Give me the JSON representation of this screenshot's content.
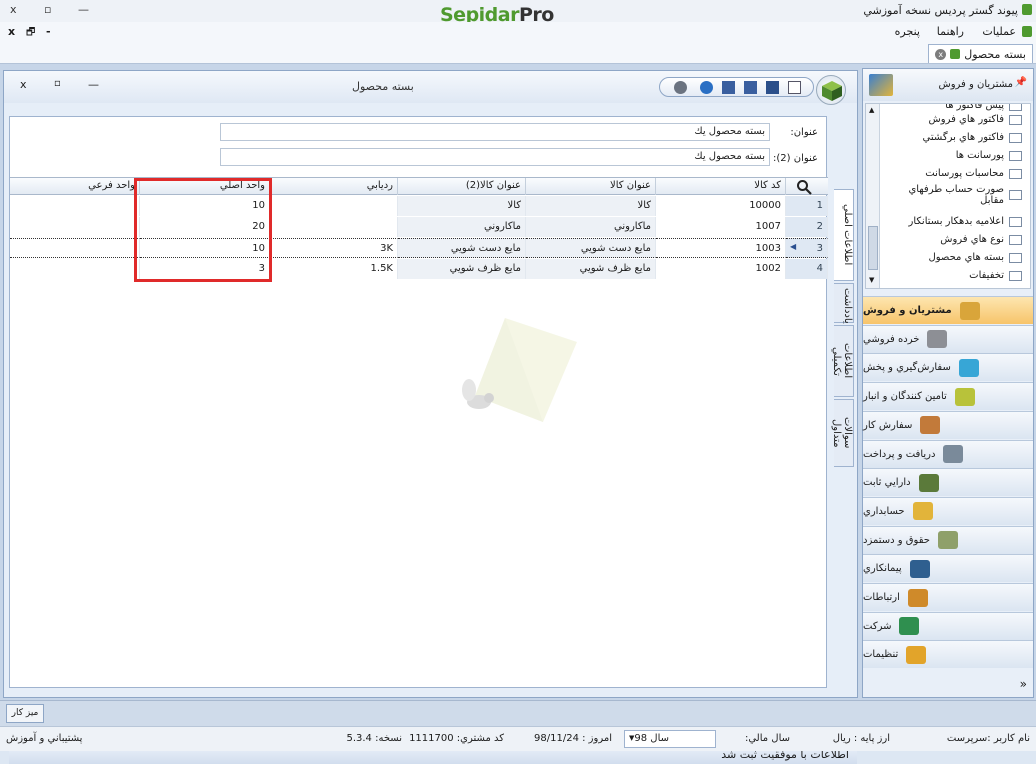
{
  "app": {
    "title": "پیوند گستر پردیس نسخه آموزشي",
    "logo_sepidar": "Sepidar",
    "logo_pro": "Pro"
  },
  "window_controls": {
    "close": "x",
    "restore": "▫",
    "minimize": "—"
  },
  "menu": {
    "items": [
      "عمليات",
      "راهنما",
      "پنجره"
    ]
  },
  "doc_tab": {
    "label": "بسته محصول"
  },
  "child_window": {
    "title": "بسته محصول",
    "vertical_tabs": [
      "اطلاعات اصلي",
      "يادداشت",
      "اطلاعات تكميلي",
      "سوالات متداول"
    ]
  },
  "form": {
    "title_label": "عنوان:",
    "title_value": "بسته محصول يك",
    "title2_label": "عنوان (2):",
    "title2_value": "بسته محصول يك"
  },
  "grid": {
    "columns": [
      "کد کالا",
      "عنوان کالا",
      "عنوان کالا(2)",
      "رديابي",
      "واحد اصلي",
      "واحد فرعي"
    ],
    "rows": [
      {
        "num": "1",
        "code": "10000",
        "title": "كالا",
        "title2": "كالا",
        "track": "",
        "main_unit": "10",
        "sub_unit": ""
      },
      {
        "num": "2",
        "code": "1007",
        "title": "ماكاروني",
        "title2": "ماكاروني",
        "track": "",
        "main_unit": "20",
        "sub_unit": ""
      },
      {
        "num": "3",
        "code": "1003",
        "title": "مايع دست شويي",
        "title2": "مايع دست شويي",
        "track": "3K",
        "main_unit": "10",
        "sub_unit": ""
      },
      {
        "num": "4",
        "code": "1002",
        "title": "مايع ظرف شويي",
        "title2": "مايع ظرف شويي",
        "track": "1.5K",
        "main_unit": "3",
        "sub_unit": ""
      }
    ]
  },
  "status_message": "اطلاعات با موفقيت ثبت شد",
  "nav": {
    "header": "مشتريان و فروش",
    "list": [
      "پيش فاكتور ها",
      "فاكتور هاي فروش",
      "فاكتور هاي برگشتي",
      "پورسانت ها",
      "محاسبات پورسانت",
      "صورت حساب طرفهاي مقابل",
      "اعلاميه بدهكار بستانكار",
      "نوع هاي فروش",
      "بسته هاي محصول",
      "تخفيفات"
    ],
    "buttons": [
      "مشتريان و فروش",
      "خرده فروشي",
      "سفارش‌گيري و پخش",
      "تامين كنندگان و انبار",
      "سفارش كار",
      "دريافت و پرداخت",
      "دارايي ثابت",
      "حسابداري",
      "حقوق و دستمزد",
      "پيمانكاري",
      "ارتباطات",
      "شركت",
      "تنظيمات"
    ],
    "button_colors": [
      "#d9a53a",
      "#8d8f95",
      "#37a6d6",
      "#b8c23a",
      "#c27a3a",
      "#7a8a9a",
      "#5b7a3a",
      "#e2b43a",
      "#8fa06a",
      "#2f5f8f",
      "#cf8a2a",
      "#2f8f4f",
      "#e2a42a"
    ]
  },
  "taskbar": {
    "button": "ميز كار"
  },
  "infobar": {
    "user": "نام كاربر :سرپرست",
    "currency": "ارز پايه : ريال",
    "fiscal_label": "سال مالي:",
    "fiscal_value": "سال 98",
    "today": "امروز : 98/11/24",
    "customer": "كد مشتري: 1111700",
    "version": "نسخه: 5.3.4",
    "support": "پشتيباني و آموزش"
  }
}
